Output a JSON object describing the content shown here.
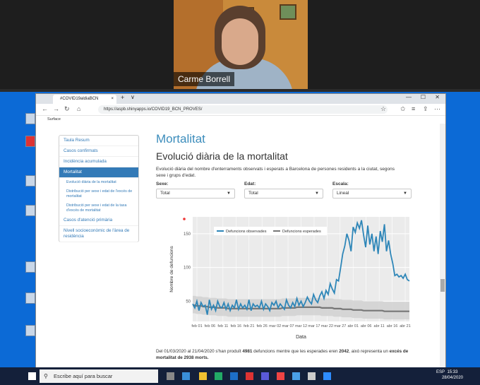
{
  "video": {
    "participant_name": "Carme Borrell"
  },
  "browser": {
    "tab_title": "#COVID19aldiaBCN",
    "tab_close": "×",
    "tab_new": "+",
    "tab_menu": "∨",
    "url": "https://aspb.shinyapps.io/COVID19_BCN_PROVES/",
    "bookmark": "Surface",
    "win_min": "—",
    "win_max": "☐",
    "win_close": "✕"
  },
  "sidebar": {
    "items": [
      {
        "label": "Taula Resum"
      },
      {
        "label": "Casos confirmats"
      },
      {
        "label": "Incidència acumulada"
      },
      {
        "label": "Mortalitat"
      },
      {
        "label": "Evolució diària de la mortalitat"
      },
      {
        "label": "Distribució per sexe i edat de l'excés de mortalitat"
      },
      {
        "label": "Distribució per sexe i edat de la taxa d'excés de mortalitat"
      },
      {
        "label": "Casos d'atenció primària"
      },
      {
        "label": "Nivell socioeconòmic de l'àrea de residència"
      }
    ]
  },
  "main": {
    "title": "Mortalitat",
    "subtitle": "Evolució diària de la mortalitat",
    "description": "Evolució diària del nombre d'enterraments observats i esperats a Barcelona de persones residents a la ciutat, segons sexe i grups d'edat.",
    "filters": [
      {
        "label": "Sexe:",
        "value": "Total"
      },
      {
        "label": "Edat:",
        "value": "Total"
      },
      {
        "label": "Escala:",
        "value": "Lineal"
      }
    ],
    "summary_pre": "Del 01/03/2020 al 21/04/2020 s'han produït ",
    "summary_observed": "4981",
    "summary_mid": " defuncions mentre que les esperades eren ",
    "summary_expected": "2042",
    "summary_mid2": ", això representa un ",
    "summary_excess": "excés de mortalitat de 2938 morts.",
    "caret": "▼"
  },
  "chart_data": {
    "type": "line",
    "xlabel": "Data",
    "ylabel": "Nombre de defuncions",
    "ylim": [
      20,
      175
    ],
    "yticks": [
      50,
      100,
      150
    ],
    "xtick_labels": [
      "feb 01",
      "feb 06",
      "feb 11",
      "feb 16",
      "feb 21",
      "feb 26",
      "mar 02",
      "mar 07",
      "mar 12",
      "mar 17",
      "mar 22",
      "mar 27",
      "abr 01",
      "abr 06",
      "abr 11",
      "abr 16",
      "abr 21"
    ],
    "series": [
      {
        "name": "Defuncions observades",
        "color": "#2e86b8",
        "values": [
          46,
          40,
          50,
          36,
          48,
          42,
          44,
          30,
          52,
          38,
          44,
          36,
          50,
          42,
          40,
          48,
          38,
          46,
          36,
          44,
          40,
          52,
          38,
          46,
          40,
          44,
          38,
          52,
          36,
          46,
          42,
          44,
          40,
          50,
          38,
          46,
          42,
          36,
          48,
          44,
          50,
          40,
          46,
          42,
          38,
          52,
          44,
          40,
          48,
          42,
          54,
          44,
          50,
          42,
          48,
          56,
          50,
          46,
          60,
          52,
          48,
          58,
          64,
          54,
          66,
          60,
          76,
          68,
          62,
          82,
          80,
          100,
          120,
          132,
          150,
          140,
          124,
          160,
          152,
          166,
          158,
          170,
          148,
          130,
          162,
          134,
          150,
          124,
          146,
          120,
          154,
          138,
          164,
          124,
          140,
          120,
          106,
          88,
          90,
          86,
          88,
          84,
          90,
          82,
          80
        ]
      },
      {
        "name": "Defuncions esperades",
        "color": "#777777",
        "values": [
          44,
          44,
          43,
          43,
          43,
          42,
          42,
          42,
          41,
          41,
          41,
          41,
          40,
          40,
          40,
          40,
          40,
          39,
          39,
          39,
          39,
          39,
          39,
          39,
          39,
          39,
          39,
          39,
          39,
          39,
          39,
          39,
          39,
          39,
          39,
          39,
          39,
          39,
          39,
          39,
          39,
          39,
          39,
          40,
          40,
          40,
          40,
          40,
          40,
          40,
          41,
          41,
          41,
          41,
          41,
          41,
          41,
          41,
          41,
          41,
          41,
          41,
          40,
          40,
          40,
          40,
          40,
          40,
          39,
          39,
          39,
          39,
          38,
          38,
          38,
          38,
          38,
          37,
          37,
          37,
          37,
          37,
          36,
          36,
          36,
          36,
          36,
          36,
          36,
          36,
          36,
          36,
          35,
          35,
          35,
          35,
          35,
          35,
          35,
          35,
          35,
          35,
          35,
          35,
          35
        ]
      }
    ],
    "legend_position": "top"
  },
  "taskbar": {
    "search_placeholder": "Escribe aquí para buscar",
    "lang": "ESP",
    "time": "15:33",
    "date": "28/04/2020"
  }
}
